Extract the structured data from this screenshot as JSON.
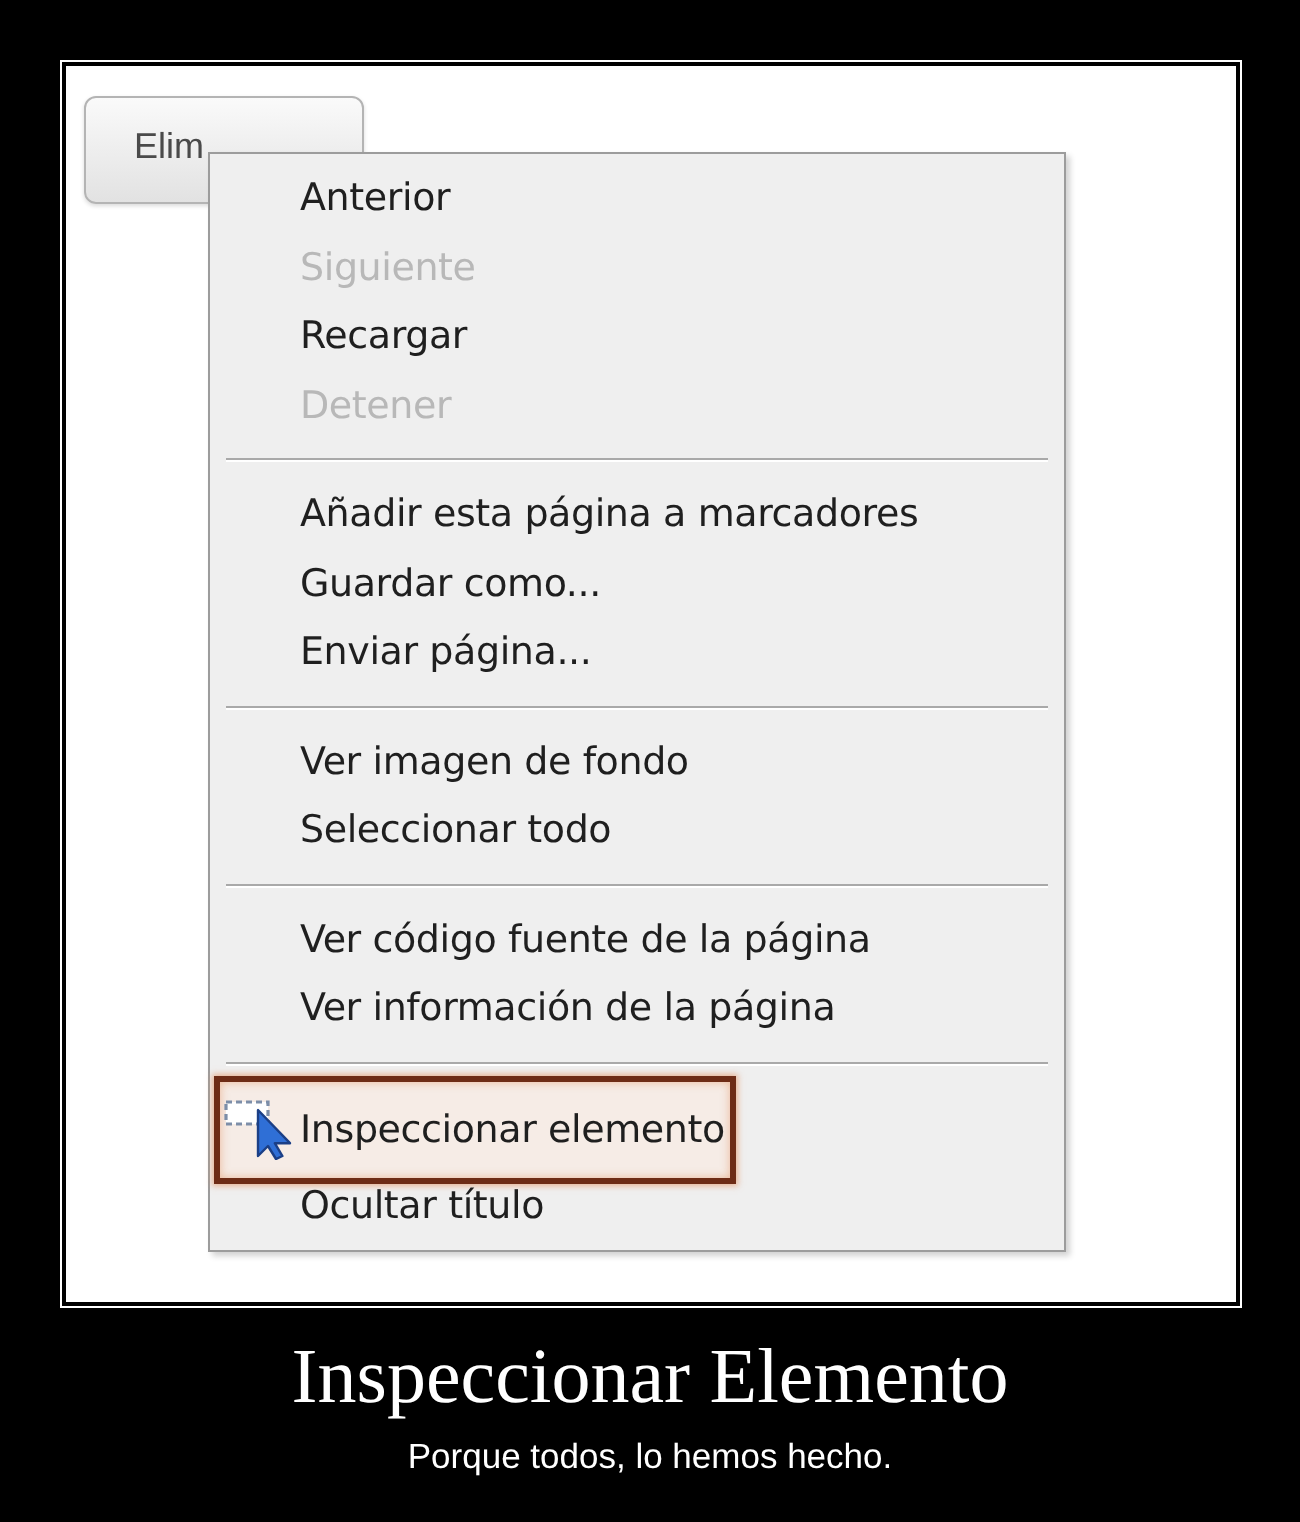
{
  "screenshot": {
    "button": {
      "label": "Elim"
    },
    "context_menu": {
      "groups": [
        {
          "items": [
            {
              "label": "Anterior",
              "kind": "command",
              "disabled": false,
              "highlighted": false
            },
            {
              "label": "Siguiente",
              "kind": "command",
              "disabled": true,
              "highlighted": false
            },
            {
              "label": "Recargar",
              "kind": "command",
              "disabled": false,
              "highlighted": false
            },
            {
              "label": "Detener",
              "kind": "command",
              "disabled": true,
              "highlighted": false
            }
          ]
        },
        {
          "items": [
            {
              "label": "Añadir esta página a marcadores",
              "kind": "command",
              "disabled": false,
              "highlighted": false
            },
            {
              "label": "Guardar como...",
              "kind": "command",
              "disabled": false,
              "highlighted": false
            },
            {
              "label": "Enviar página...",
              "kind": "command",
              "disabled": false,
              "highlighted": false
            }
          ]
        },
        {
          "items": [
            {
              "label": "Ver imagen de fondo",
              "kind": "command",
              "disabled": false,
              "highlighted": false
            },
            {
              "label": "Seleccionar todo",
              "kind": "command",
              "disabled": false,
              "highlighted": false
            }
          ]
        },
        {
          "items": [
            {
              "label": "Ver código fuente de la página",
              "kind": "command",
              "disabled": false,
              "highlighted": false
            },
            {
              "label": "Ver información de la página",
              "kind": "command",
              "disabled": false,
              "highlighted": false
            }
          ]
        },
        {
          "items": [
            {
              "label": "Inspeccionar elemento",
              "kind": "tool",
              "disabled": false,
              "highlighted": true
            },
            {
              "label": "Ocultar título",
              "kind": "command",
              "disabled": false,
              "highlighted": false
            }
          ]
        }
      ]
    }
  },
  "caption": {
    "title": "Inspeccionar Elemento",
    "subtitle": "Porque todos, lo hemos hecho."
  }
}
